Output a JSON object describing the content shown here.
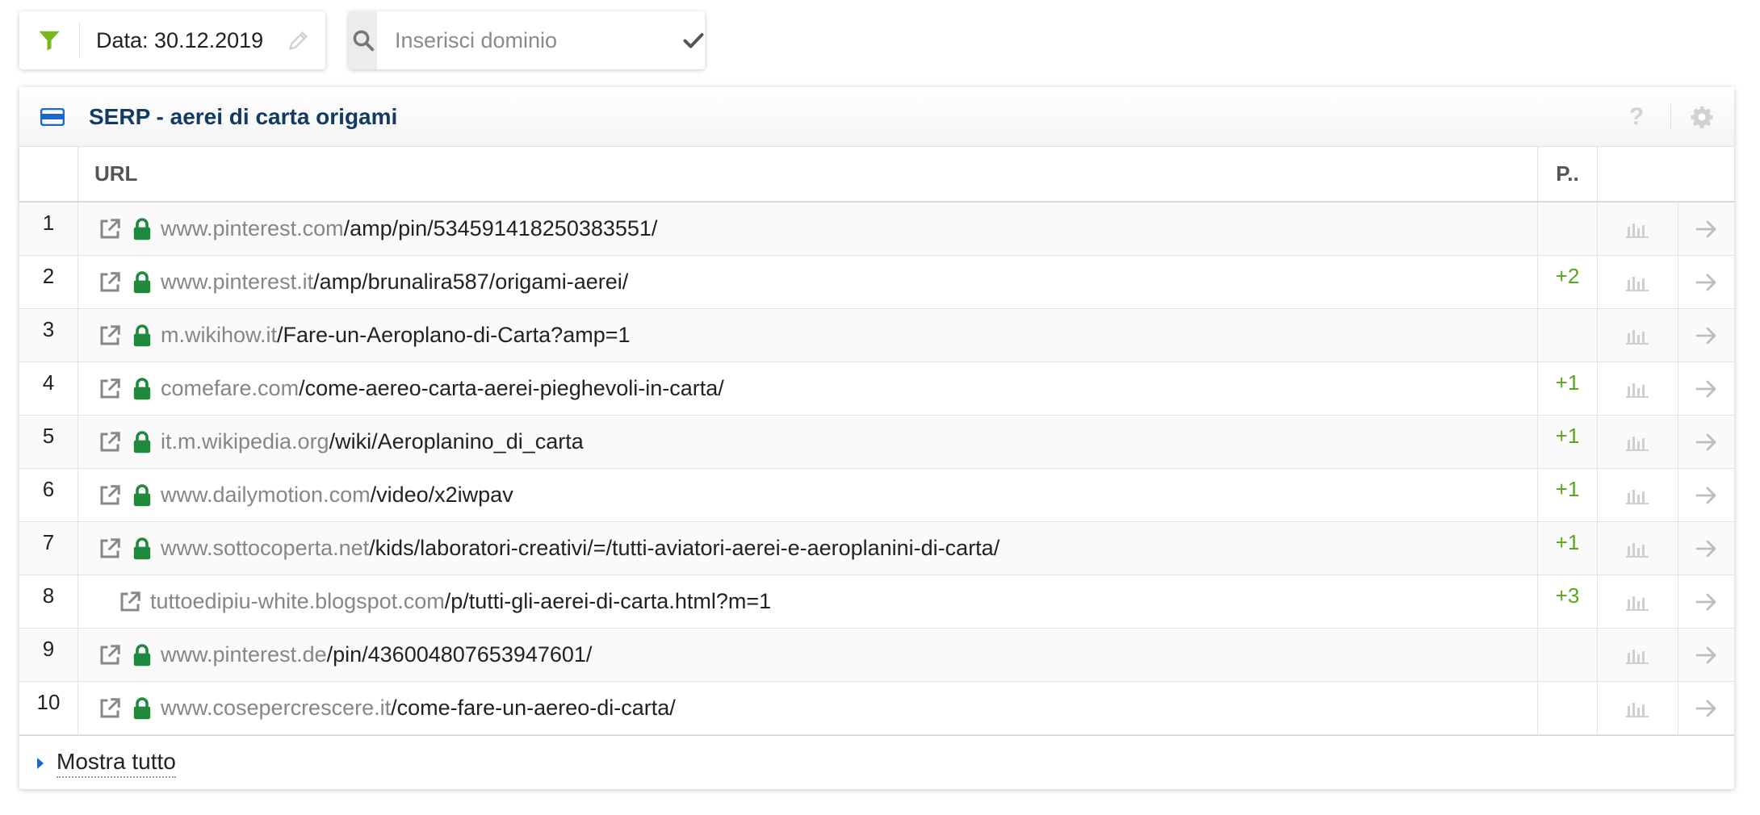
{
  "toolbar": {
    "filter_label": "Data: 30.12.2019",
    "search_placeholder": "Inserisci dominio",
    "search_value": ""
  },
  "panel": {
    "title": "SERP - aerei di carta origami",
    "help_label": "?"
  },
  "table": {
    "columns": {
      "num": "",
      "url": "URL",
      "pos": "P.."
    },
    "rows": [
      {
        "num": "1",
        "domain": "www.pinterest.com",
        "path": "/amp/pin/534591418250383551/",
        "secure": true,
        "change": ""
      },
      {
        "num": "2",
        "domain": "www.pinterest.it",
        "path": "/amp/brunalira587/origami-aerei/",
        "secure": true,
        "change": "+2"
      },
      {
        "num": "3",
        "domain": "m.wikihow.it",
        "path": "/Fare-un-Aeroplano-di-Carta?amp=1",
        "secure": true,
        "change": ""
      },
      {
        "num": "4",
        "domain": "comefare.com",
        "path": "/come-aereo-carta-aerei-pieghevoli-in-carta/",
        "secure": true,
        "change": "+1"
      },
      {
        "num": "5",
        "domain": "it.m.wikipedia.org",
        "path": "/wiki/Aeroplanino_di_carta",
        "secure": true,
        "change": "+1"
      },
      {
        "num": "6",
        "domain": "www.dailymotion.com",
        "path": "/video/x2iwpav",
        "secure": true,
        "change": "+1"
      },
      {
        "num": "7",
        "domain": "www.sottocoperta.net",
        "path": "/kids/laboratori-creativi/=/tutti-aviatori-aerei-e-aeroplanini-di-carta/",
        "secure": true,
        "change": "+1"
      },
      {
        "num": "8",
        "domain": "tuttoedipiu-white.blogspot.com",
        "path": "/p/tutti-gli-aerei-di-carta.html?m=1",
        "secure": false,
        "change": "+3"
      },
      {
        "num": "9",
        "domain": "www.pinterest.de",
        "path": "/pin/436004807653947601/",
        "secure": true,
        "change": ""
      },
      {
        "num": "10",
        "domain": "www.cosepercrescere.it",
        "path": "/come-fare-un-aereo-di-carta/",
        "secure": true,
        "change": ""
      }
    ]
  },
  "footer": {
    "show_all": "Mostra tutto"
  },
  "colors": {
    "accent_green": "#5aa51e",
    "lock_green": "#1f8a3c",
    "filter_green": "#78b81e",
    "title_navy": "#123a63",
    "link_blue": "#2a6fc9"
  },
  "icons": {
    "filter": "filter-icon",
    "edit": "pencil-icon",
    "search": "search-icon",
    "confirm": "check-icon",
    "panel": "card-icon",
    "help": "help-icon",
    "settings": "gear-icon",
    "external": "external-link-icon",
    "secure": "lock-icon",
    "chart": "bar-chart-icon",
    "open": "arrow-right-icon",
    "expand": "caret-right-icon"
  }
}
